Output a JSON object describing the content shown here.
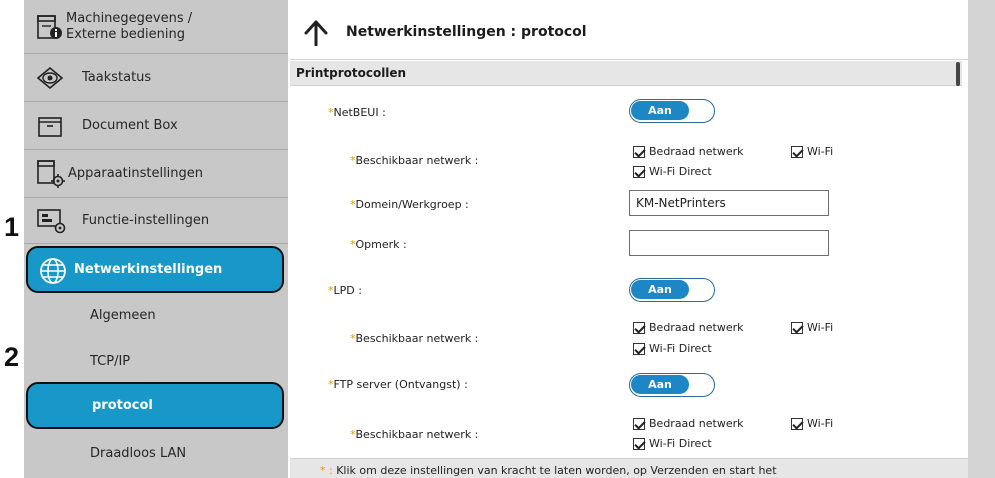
{
  "steps": {
    "one": "1",
    "two": "2"
  },
  "sidebar": {
    "items": [
      {
        "label": "Machinegegevens /",
        "label2": "Externe bediening",
        "icon": "device-info-icon"
      },
      {
        "label": "Taakstatus",
        "icon": "eye-icon"
      },
      {
        "label": "Document Box",
        "icon": "folder-icon"
      },
      {
        "label": "Apparaatinstellingen",
        "icon": "device-settings-icon"
      },
      {
        "label": "Functie-instellingen",
        "icon": "function-settings-icon"
      },
      {
        "label": "Netwerkinstellingen",
        "icon": "globe-icon",
        "active": true
      }
    ],
    "subitems": [
      {
        "label": "Algemeen"
      },
      {
        "label": "TCP/IP"
      },
      {
        "label": "protocol",
        "active": true
      },
      {
        "label": "Draadloos LAN"
      }
    ]
  },
  "main": {
    "title": "Netwerkinstellingen : protocol",
    "section": "Printprotocollen",
    "rows": {
      "netbeui": {
        "label": "NetBEUI :",
        "toggle": "Aan"
      },
      "netbeui_network": {
        "label": "Beschikbaar netwerk :",
        "options": [
          "Bedraad netwerk",
          "Wi-Fi",
          "Wi-Fi Direct"
        ]
      },
      "domain": {
        "label": "Domein/Werkgroep :",
        "value": "KM-NetPrinters"
      },
      "comment": {
        "label": "Opmerk :",
        "value": ""
      },
      "lpd": {
        "label": "LPD :",
        "toggle": "Aan"
      },
      "lpd_network": {
        "label": "Beschikbaar netwerk :",
        "options": [
          "Bedraad netwerk",
          "Wi-Fi",
          "Wi-Fi Direct"
        ]
      },
      "ftp": {
        "label": "FTP server (Ontvangst) :",
        "toggle": "Aan"
      },
      "ftp_network": {
        "label": "Beschikbaar netwerk :",
        "options": [
          "Bedraad netwerk",
          "Wi-Fi",
          "Wi-Fi Direct"
        ]
      }
    },
    "asterisk": "*",
    "footer": {
      "asterisk": "* :",
      "note": "Klik  om deze instellingen van kracht te laten worden, op Verzenden en start het"
    }
  },
  "colors": {
    "accent": "#1798c8",
    "toggle_on": "#1d86c4",
    "required": "#e09a00"
  }
}
